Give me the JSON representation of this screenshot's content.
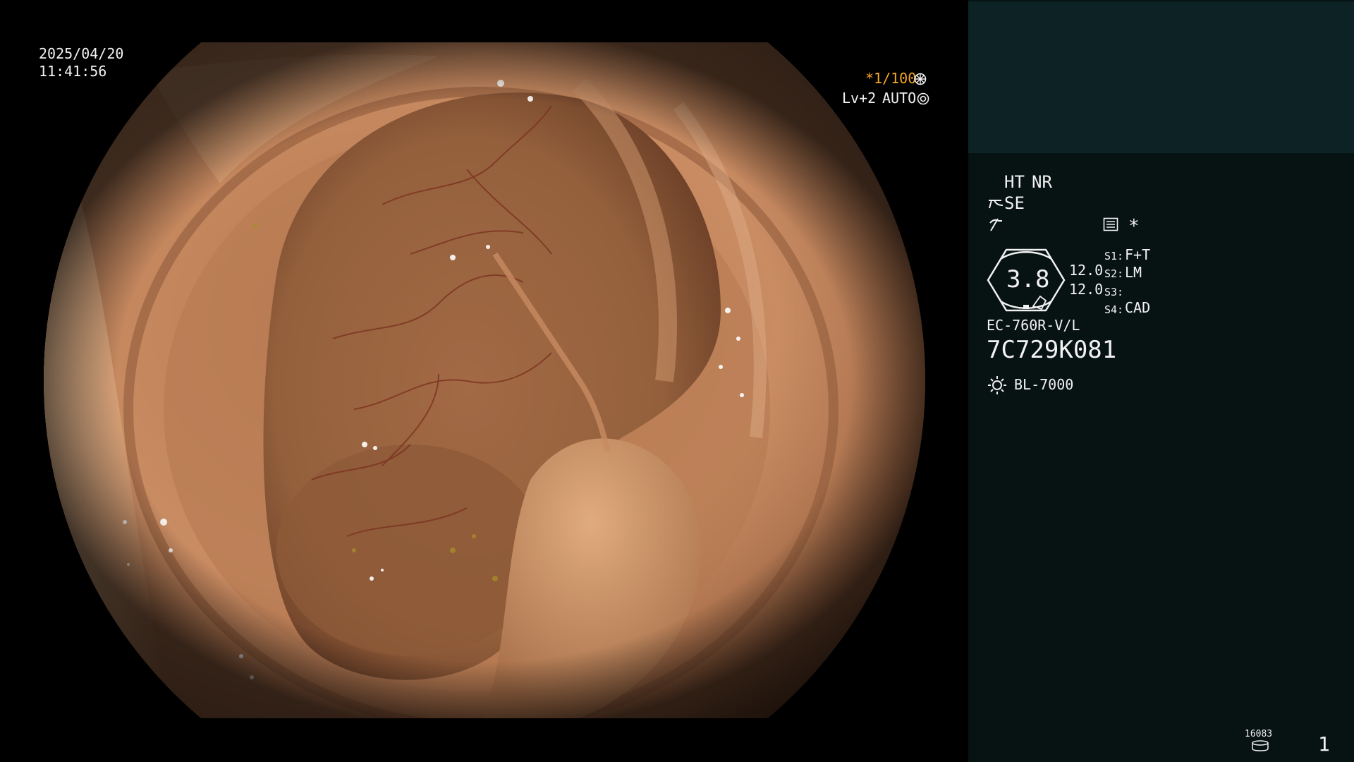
{
  "overlay": {
    "date": "2025/04/20",
    "time": "11:41:56",
    "shutter": "*1/100",
    "level": "Lv+2",
    "iris_mode": "AUTO"
  },
  "panel": {
    "ht_label": "HT",
    "nr_label": "NR",
    "se_label": "SE",
    "star_label": "*",
    "aperture_value": "3.8",
    "value_top": "12.0",
    "value_bottom": "12.0",
    "switches": [
      {
        "key": "S1:",
        "value": "F+T"
      },
      {
        "key": "S2:",
        "value": "LM"
      },
      {
        "key": "S3:",
        "value": ""
      },
      {
        "key": "S4:",
        "value": "CAD"
      }
    ],
    "scope_model": "EC-760R-V/L",
    "scope_serial": "7C729K081",
    "light_source": "BL-7000",
    "storage_count": "16083",
    "page_number": "1"
  },
  "colors": {
    "accent_amber": "#f5a623",
    "panel_bg": "#071213",
    "thumb_bg": "#0c2224",
    "text": "#f2f2f2"
  },
  "icons": {
    "shutter": "flower-icon",
    "iris": "gear-icon",
    "scope_type": "scope-icon",
    "signal": "waveform-icon",
    "menu": "list-icon",
    "light": "sun-icon",
    "storage": "disk-icon"
  }
}
